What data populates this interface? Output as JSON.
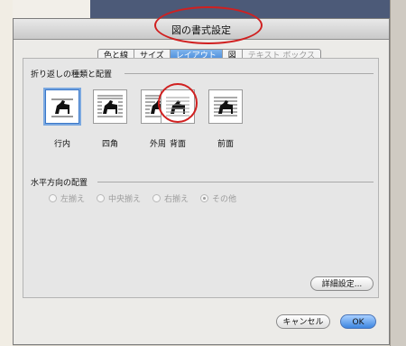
{
  "dialog": {
    "title": "図の書式設定"
  },
  "tabs": [
    {
      "label": "色と線",
      "active": false
    },
    {
      "label": "サイズ",
      "active": false
    },
    {
      "label": "レイアウト",
      "active": true
    },
    {
      "label": "図",
      "active": false
    },
    {
      "label": "テキスト ボックス",
      "active": false,
      "disabled": true
    }
  ],
  "wrapping": {
    "section_label": "折り返しの種類と配置",
    "options": [
      {
        "label": "行内",
        "icon": "inline-wrap-icon",
        "selected": true
      },
      {
        "label": "四角",
        "icon": "square-wrap-icon",
        "selected": false
      },
      {
        "label": "外周",
        "icon": "tight-wrap-icon",
        "selected": false
      },
      {
        "label": "背面",
        "icon": "behind-text-icon",
        "selected": false
      },
      {
        "label": "前面",
        "icon": "in-front-of-text-icon",
        "selected": false
      }
    ]
  },
  "alignment": {
    "section_label": "水平方向の配置",
    "options": [
      {
        "label": "左揃え",
        "checked": false
      },
      {
        "label": "中央揃え",
        "checked": false
      },
      {
        "label": "右揃え",
        "checked": false
      },
      {
        "label": "その他",
        "checked": true
      }
    ],
    "disabled": true
  },
  "buttons": {
    "advanced": "詳細設定...",
    "cancel": "キャンセル",
    "ok": "OK"
  },
  "colors": {
    "highlight_oval": "#d02020",
    "selected_border": "#3b78c9",
    "ok_button": "#3d86e0"
  }
}
